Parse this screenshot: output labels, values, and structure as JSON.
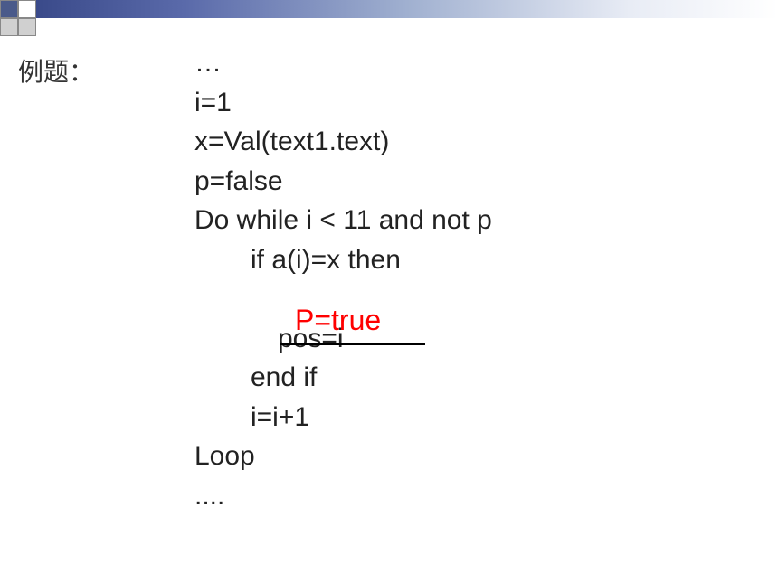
{
  "title": "例题：",
  "code": {
    "line1": "…",
    "line2": "i=1",
    "line3": "x=Val(text1.text)",
    "line4": "p=false",
    "line5": "Do while i < 11 and not p",
    "line6": "if a(i)=x then",
    "line7_answer": "P=true",
    "line8": "pos=i",
    "line9": "end if",
    "line10": "i=i+1",
    "line11": "Loop",
    "line12": "...."
  }
}
